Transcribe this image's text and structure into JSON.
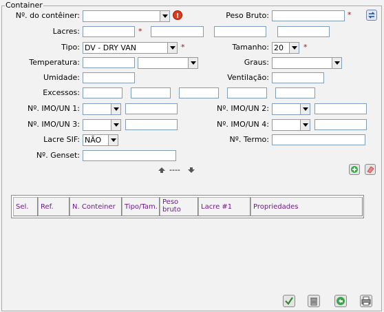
{
  "section_title": "Container",
  "labels": {
    "container_no": "Nº. do contêiner:",
    "lacres": "Lacres:",
    "tipo": "Tipo:",
    "temperatura": "Temperatura:",
    "umidade": "Umidade:",
    "excessos": "Excessos:",
    "imo1": "Nº. IMO/UN 1:",
    "imo3": "Nº. IMO/UN 3:",
    "lacre_sif": "Lacre SIF:",
    "genset": "Nº. Genset:",
    "peso_bruto": "Peso Bruto:",
    "tamanho": "Tamanho:",
    "graus": "Graus:",
    "ventilacao": "Ventilação:",
    "imo2": "Nº. IMO/UN 2:",
    "imo4": "Nº. IMO/UN 4:",
    "termo": "Nº. Termo:"
  },
  "values": {
    "tipo": "DV - DRY VAN",
    "tamanho": "20",
    "lacre_sif": "NÃO"
  },
  "required_mark": "*",
  "nav_separator": "----",
  "grid_columns": [
    "Sel.",
    "Ref.",
    "N. Conteiner",
    "Tipo/Tam.",
    "Peso bruto",
    "Lacre #1",
    "Propriedades"
  ],
  "colors": {
    "grid_header_text": "#6b1a87",
    "required": "#d00000",
    "input_border": "#7f9db9"
  },
  "icons": {
    "info": "info-icon",
    "refresh": "refresh-icon",
    "add": "add-icon",
    "eraser": "eraser-icon",
    "confirm": "check-icon",
    "delete": "trash-icon",
    "undo": "undo-icon",
    "print": "print-icon"
  }
}
